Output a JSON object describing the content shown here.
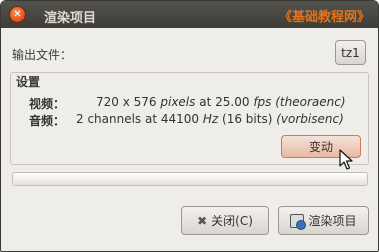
{
  "window": {
    "title": "渲染项目",
    "watermark": "《基础教程网》",
    "close_glyph": "✕"
  },
  "output": {
    "label": "输出文件：",
    "button_label": "tz1"
  },
  "settings": {
    "title": "设置",
    "video": {
      "label": "视频：",
      "resolution": "720 x 576",
      "pixels_word": "pixels",
      "at_word": "at",
      "fps_value": "25.00",
      "fps_unit": "fps",
      "codec": "(theoraenc)"
    },
    "audio": {
      "label": "音频：",
      "channels": "2 channels at 44100",
      "hz_unit": "Hz",
      "bits": "(16 bits)",
      "codec": "(vorbisenc)"
    },
    "change_label": "变动"
  },
  "progress": {
    "value": 0
  },
  "buttons": {
    "close_icon": "✖",
    "close_label": "关闭(C)",
    "render_label": "渲染项目"
  },
  "colors": {
    "titlebar": "#3d3c37",
    "watermark": "#e4721a",
    "close_button": "#e24c15",
    "window_bg": "#efedea",
    "change_button": "#e8b9a3"
  }
}
